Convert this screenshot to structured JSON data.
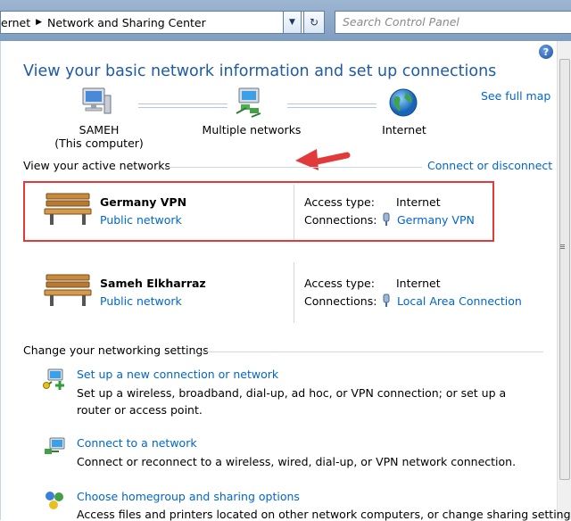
{
  "address_bar": {
    "crumbs": [
      "ernet",
      "Network and Sharing Center"
    ],
    "refresh_glyph": "↻",
    "search_placeholder": "Search Control Panel"
  },
  "page": {
    "title": "View your basic network information and set up connections",
    "see_full_map": "See full map"
  },
  "map": {
    "computer_name": "SAMEH",
    "computer_sub": "(This computer)",
    "middle_label": "Multiple networks",
    "internet_label": "Internet"
  },
  "active_networks": {
    "header": "View your active networks",
    "connect_link": "Connect or disconnect",
    "networks": [
      {
        "name": "Germany VPN",
        "category": "Public network",
        "access_label": "Access type:",
        "access_value": "Internet",
        "conn_label": "Connections:",
        "conn_value": "Germany VPN"
      },
      {
        "name": "Sameh Elkharraz",
        "category": "Public network",
        "access_label": "Access type:",
        "access_value": "Internet",
        "conn_label": "Connections:",
        "conn_value": "Local Area Connection"
      }
    ]
  },
  "settings": {
    "header": "Change your networking settings",
    "tasks": [
      {
        "link": "Set up a new connection or network",
        "desc": "Set up a wireless, broadband, dial-up, ad hoc, or VPN connection; or set up a router or access point."
      },
      {
        "link": "Connect to a network",
        "desc": "Connect or reconnect to a wireless, wired, dial-up, or VPN network connection."
      },
      {
        "link": "Choose homegroup and sharing options",
        "desc": "Access files and printers located on other network computers, or change sharing settings."
      }
    ]
  },
  "colors": {
    "link": "#0066cc",
    "title": "#1e5aa8",
    "highlight": "#e23a3a"
  }
}
